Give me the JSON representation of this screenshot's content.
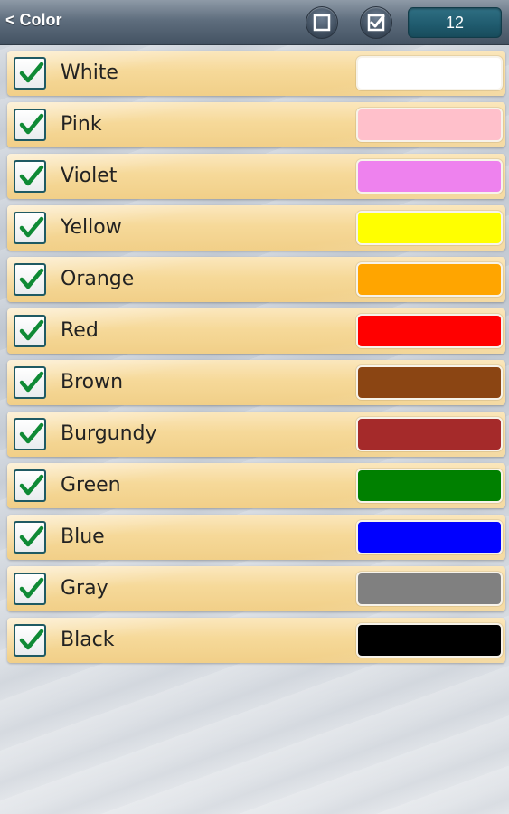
{
  "header": {
    "back_label": "< Color",
    "count": "12"
  },
  "colors": [
    {
      "name": "White",
      "hex": "#FFFFFF",
      "checked": true
    },
    {
      "name": "Pink",
      "hex": "#FFC0CB",
      "checked": true
    },
    {
      "name": "Violet",
      "hex": "#EE82EE",
      "checked": true
    },
    {
      "name": "Yellow",
      "hex": "#FFFF00",
      "checked": true
    },
    {
      "name": "Orange",
      "hex": "#FFA500",
      "checked": true
    },
    {
      "name": "Red",
      "hex": "#FF0000",
      "checked": true
    },
    {
      "name": "Brown",
      "hex": "#8B4513",
      "checked": true
    },
    {
      "name": "Burgundy",
      "hex": "#A52A2A",
      "checked": true
    },
    {
      "name": "Green",
      "hex": "#008000",
      "checked": true
    },
    {
      "name": "Blue",
      "hex": "#0000FF",
      "checked": true
    },
    {
      "name": "Gray",
      "hex": "#808080",
      "checked": true
    },
    {
      "name": "Black",
      "hex": "#000000",
      "checked": true
    }
  ]
}
